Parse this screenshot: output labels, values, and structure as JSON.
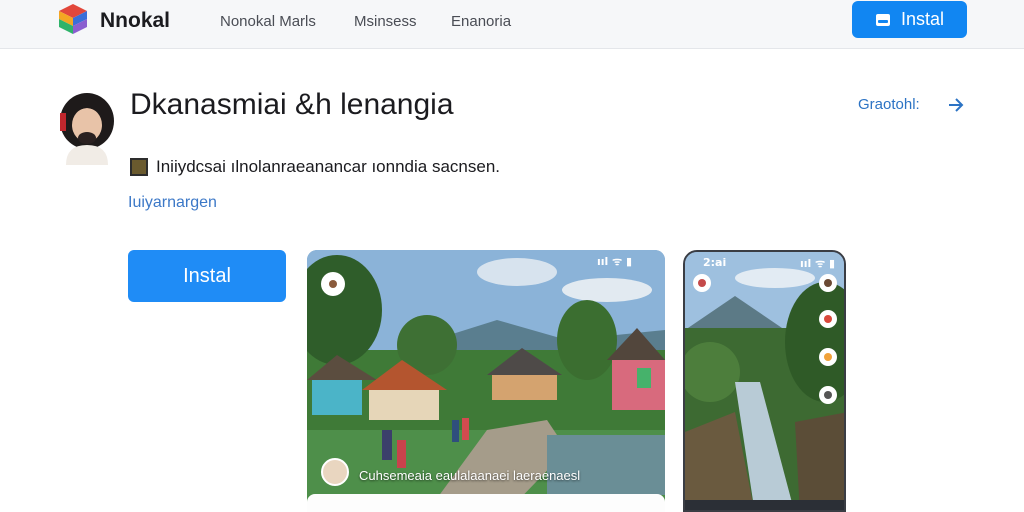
{
  "topbar": {
    "brand": "Nnokal",
    "nav": [
      "Nonokal Marls",
      "Msinsess",
      "Enanoria"
    ],
    "install_label": "Instal"
  },
  "app": {
    "title": "Dkanasmiai &h lenangia",
    "share_label": "Graotohl:",
    "publisher": "Iniiydcsai ılnolanraeanancar ıonndia sacnsen.",
    "category": "Iuiyarnargen",
    "install_label": "Instal"
  },
  "screenshots": {
    "shot1_caption": "Cuhsemeaia eaulalaanaei laeraenaesl",
    "shot1_status": "ııl ᯤ ▮",
    "shot2_status_left": "2:ai",
    "shot2_status_right": "ııl ᯤ ▮"
  },
  "colors": {
    "accent": "#1186f2",
    "link": "#3c78c7",
    "topbar_bg": "#f6f7f9"
  }
}
